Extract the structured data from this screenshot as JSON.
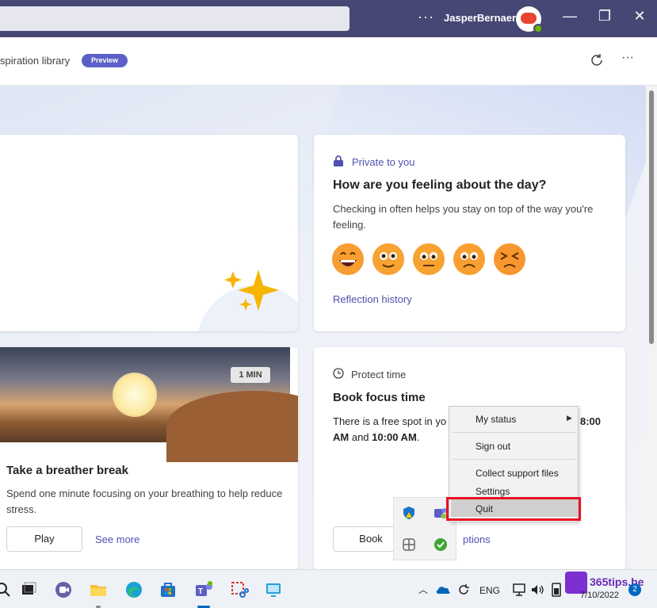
{
  "titlebar": {
    "more": "···",
    "user_name": "JasperBernaers",
    "minimize": "—",
    "restore": "❐",
    "close": "✕"
  },
  "subheader": {
    "title": "spiration library",
    "preview_badge": "Preview",
    "more": "···"
  },
  "cards": {
    "feeling": {
      "private_label": "Private to you",
      "title": "How are you feeling about the day?",
      "description": "Checking in often helps you stay on top of the way you're feeling.",
      "emojis": [
        "grinning-face",
        "smiling-face",
        "neutral-face",
        "frowning-face",
        "tired-face"
      ],
      "link": "Reflection history"
    },
    "breather": {
      "duration_badge": "1 MIN",
      "title": "Take a breather break",
      "description": "Spend one minute focusing on your breathing to help reduce stress.",
      "play_button": "Play",
      "see_more_link": "See more"
    },
    "protect": {
      "label": "Protect time",
      "title": "Book focus time",
      "desc_line1": "There is a free spot in yo",
      "desc_time1": "8:00",
      "desc_am": "AM",
      "desc_and": "and",
      "desc_time2": "10:00 AM",
      "desc_end": ".",
      "book_button": "Book",
      "options_link": "ptions"
    }
  },
  "context_menu": {
    "my_status": "My status",
    "sign_out": "Sign out",
    "collect_support": "Collect support files",
    "settings": "Settings",
    "quit": "Quit"
  },
  "taskbar": {
    "language": "ENG",
    "date": "7/10/2022",
    "notification_count": "2",
    "brand": "365tips.be"
  },
  "colors": {
    "titlebar": "#464775",
    "accent": "#4f52b2",
    "preview": "#5b5fc7",
    "highlight": "#e81123"
  }
}
